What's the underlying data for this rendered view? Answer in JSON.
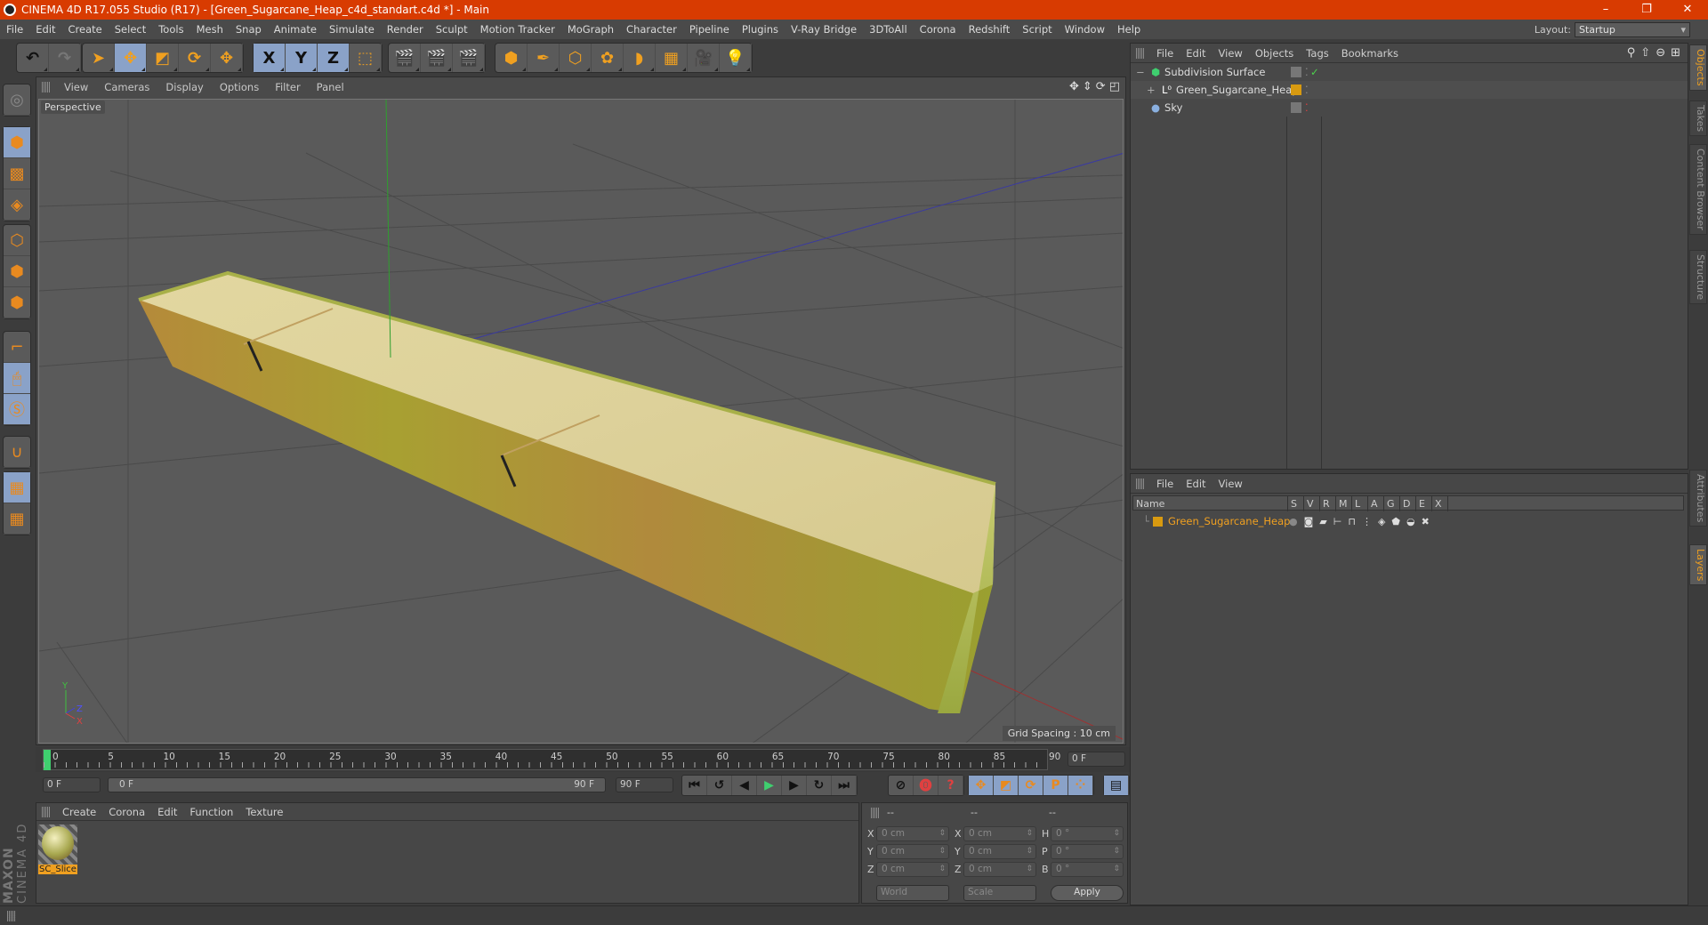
{
  "window": {
    "title": "CINEMA 4D R17.055 Studio (R17) - [Green_Sugarcane_Heap_c4d_standart.c4d *] - Main",
    "controls": [
      "–",
      "❐",
      "✕"
    ]
  },
  "menubar": {
    "items": [
      "File",
      "Edit",
      "Create",
      "Select",
      "Tools",
      "Mesh",
      "Snap",
      "Animate",
      "Simulate",
      "Render",
      "Sculpt",
      "Motion Tracker",
      "MoGraph",
      "Character",
      "Pipeline",
      "Plugins",
      "V-Ray Bridge",
      "3DToAll",
      "Corona",
      "Redshift",
      "Script",
      "Window",
      "Help"
    ],
    "layout_label": "Layout:",
    "layout_value": "Startup"
  },
  "toolbar": {
    "groups": [
      {
        "name": "history",
        "items": [
          {
            "icon": "undo-icon",
            "glyph": "↶"
          },
          {
            "icon": "redo-icon",
            "glyph": "↷"
          }
        ]
      },
      {
        "name": "tools",
        "items": [
          {
            "icon": "live-selection-icon",
            "glyph": "➤"
          },
          {
            "icon": "move-icon",
            "glyph": "✥",
            "active": true
          },
          {
            "icon": "scale-icon",
            "glyph": "◩"
          },
          {
            "icon": "rotate-icon",
            "glyph": "⟳"
          },
          {
            "icon": "recent-tool-icon",
            "glyph": "✥"
          }
        ]
      },
      {
        "name": "axes",
        "items": [
          {
            "icon": "x-axis-lock-icon",
            "glyph": "X",
            "active": true
          },
          {
            "icon": "y-axis-lock-icon",
            "glyph": "Y",
            "active": true
          },
          {
            "icon": "z-axis-lock-icon",
            "glyph": "Z",
            "active": true
          },
          {
            "icon": "coordinate-system-icon",
            "glyph": "⬚"
          }
        ]
      },
      {
        "name": "render",
        "items": [
          {
            "icon": "render-view-icon",
            "glyph": "🎬"
          },
          {
            "icon": "render-picture-viewer-icon",
            "glyph": "🎬"
          },
          {
            "icon": "render-settings-icon",
            "glyph": "🎬"
          }
        ]
      },
      {
        "name": "create",
        "items": [
          {
            "icon": "cube-icon",
            "glyph": "⬢"
          },
          {
            "icon": "pen-spline-icon",
            "glyph": "✒"
          },
          {
            "icon": "subdivision-surface-icon",
            "glyph": "⬡"
          },
          {
            "icon": "cloner-icon",
            "glyph": "✿"
          },
          {
            "icon": "deformer-bend-icon",
            "glyph": "◗"
          },
          {
            "icon": "floor-icon",
            "glyph": "▦"
          },
          {
            "icon": "camera-icon",
            "glyph": "🎥"
          },
          {
            "icon": "light-icon",
            "glyph": "💡"
          }
        ]
      }
    ]
  },
  "left_tools": [
    {
      "icon": "make-editable-icon",
      "active": false
    },
    {
      "icon": "model-mode-icon",
      "active": true
    },
    {
      "icon": "texture-mode-icon",
      "active": false
    },
    {
      "icon": "workplane-mode-icon",
      "active": false
    },
    {
      "icon": "points-mode-icon",
      "active": false
    },
    {
      "icon": "edges-mode-icon",
      "active": false
    },
    {
      "icon": "polygons-mode-icon",
      "active": false
    },
    {
      "icon": "axis-mode-icon",
      "active": false
    },
    {
      "icon": "tweak-mode-icon",
      "active": true
    },
    {
      "icon": "solo-mode-icon",
      "active": true
    },
    {
      "icon": "snapping-icon",
      "active": false
    },
    {
      "icon": "locked-workplane-icon",
      "active": true
    },
    {
      "icon": "planar-workplane-icon",
      "active": false
    }
  ],
  "viewport": {
    "menu": [
      "View",
      "Cameras",
      "Display",
      "Options",
      "Filter",
      "Panel"
    ],
    "camera_label": "Perspective",
    "grid_spacing": "Grid Spacing : 10 cm",
    "axis_labels": {
      "y": "Y",
      "z": "Z",
      "x": "X"
    },
    "nav_icons": [
      "move-view-icon",
      "zoom-view-icon",
      "rotate-view-icon",
      "maximize-view-icon"
    ]
  },
  "timeline": {
    "ticks": [
      "0",
      "5",
      "10",
      "15",
      "20",
      "25",
      "30",
      "35",
      "40",
      "45",
      "50",
      "55",
      "60",
      "65",
      "70",
      "75",
      "80",
      "85",
      "90"
    ],
    "current_frame": "0 F",
    "start_field": "0 F",
    "range_start": "0 F",
    "range_end": "90 F",
    "end_field": "90 F"
  },
  "transport": {
    "buttons": [
      {
        "icon": "go-to-start-icon",
        "glyph": "⏮"
      },
      {
        "icon": "previous-key-icon",
        "glyph": "↺"
      },
      {
        "icon": "previous-frame-icon",
        "glyph": "◀"
      },
      {
        "icon": "play-icon",
        "glyph": "▶"
      },
      {
        "icon": "next-frame-icon",
        "glyph": "▶"
      },
      {
        "icon": "next-key-icon",
        "glyph": "↻"
      },
      {
        "icon": "go-to-end-icon",
        "glyph": "⏭"
      }
    ],
    "key_buttons": [
      {
        "icon": "motion-record-icon",
        "glyph": "⊘"
      },
      {
        "icon": "record-keys-icon",
        "glyph": "⓿"
      },
      {
        "icon": "auto-keying-icon",
        "glyph": "?"
      }
    ],
    "track_buttons": [
      {
        "icon": "position-track-icon",
        "glyph": "✥"
      },
      {
        "icon": "scale-track-icon",
        "glyph": "◩"
      },
      {
        "icon": "rotation-track-icon",
        "glyph": "⟳"
      },
      {
        "icon": "parameter-track-icon",
        "glyph": "P"
      },
      {
        "icon": "point-level-animation-icon",
        "glyph": "⁘"
      }
    ],
    "timeline_button": {
      "icon": "timeline-window-icon",
      "glyph": "▤"
    }
  },
  "material_manager": {
    "menu": [
      "Create",
      "Corona",
      "Edit",
      "Function",
      "Texture"
    ],
    "materials": [
      {
        "name": "SC_Slice",
        "selected": true
      }
    ]
  },
  "coordinates": {
    "headers": [
      "--",
      "--",
      "--"
    ],
    "rows": [
      {
        "pos_label": "X",
        "pos": "0 cm",
        "size_label": "X",
        "size": "0 cm",
        "rot_label": "H",
        "rot": "0 °"
      },
      {
        "pos_label": "Y",
        "pos": "0 cm",
        "size_label": "Y",
        "size": "0 cm",
        "rot_label": "P",
        "rot": "0 °"
      },
      {
        "pos_label": "Z",
        "pos": "0 cm",
        "size_label": "Z",
        "size": "0 cm",
        "rot_label": "B",
        "rot": "0 °"
      }
    ],
    "mode_select": "World",
    "scale_select": "Scale",
    "apply_label": "Apply"
  },
  "object_manager": {
    "menu": [
      "File",
      "Edit",
      "View",
      "Objects",
      "Tags",
      "Bookmarks"
    ],
    "objects": [
      {
        "name": "Subdivision Surface",
        "icon": "subdivision-surface-icon",
        "indent": 0,
        "expand": "−",
        "tag": "grey",
        "check": "✓",
        "check_color": "#4cd34c"
      },
      {
        "name": "Green_Sugarcane_Heap",
        "icon": "null-object-icon",
        "indent": 1,
        "expand": "+",
        "tag": "#d89a10",
        "check": "",
        "check_color": ""
      },
      {
        "name": "Sky",
        "icon": "sky-icon",
        "indent": 0,
        "expand": "",
        "tag": "grey",
        "check": "",
        "check_color": "#e04040"
      }
    ]
  },
  "layer_manager": {
    "menu": [
      "File",
      "Edit",
      "View"
    ],
    "columns": [
      "Name",
      "S",
      "V",
      "R",
      "M",
      "L",
      "A",
      "G",
      "D",
      "E",
      "X"
    ],
    "layers": [
      {
        "name": "Green_Sugarcane_Heap",
        "color": "#d89a10"
      }
    ]
  },
  "side_tabs": {
    "top": [
      {
        "label": "Objects",
        "active": true
      },
      {
        "label": "Takes",
        "active": false
      },
      {
        "label": "Content Browser",
        "active": false
      },
      {
        "label": "Structure",
        "active": false
      }
    ],
    "bottom": [
      {
        "label": "Attributes",
        "active": false
      },
      {
        "label": "Layers",
        "active": true
      }
    ]
  },
  "branding": {
    "line1": "MAXON",
    "line2": "CINEMA 4D"
  },
  "colors": {
    "title_bar": "#d83b01",
    "accent": "#f0a020",
    "active_tool": "#8aa2c8",
    "playhead": "#3fcf6f"
  }
}
